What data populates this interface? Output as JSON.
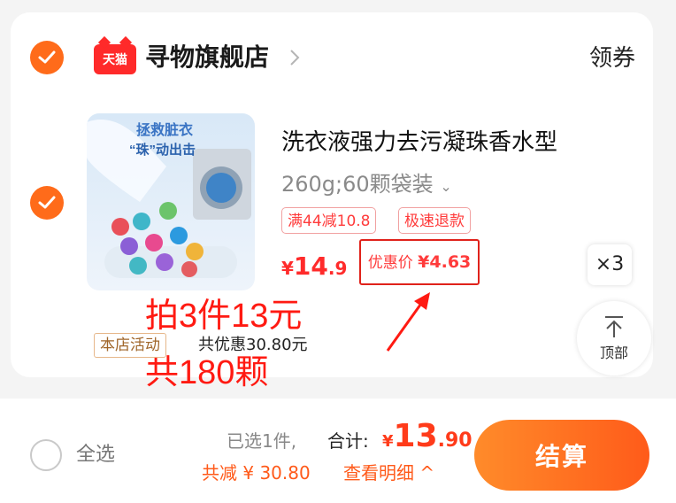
{
  "store": {
    "platform_badge": "天猫",
    "name": "寻物旗舰店",
    "coupon_label": "领券"
  },
  "product": {
    "image_text_line1": "拯救脏衣",
    "image_text_line2": "“珠”动出击",
    "title": "洗衣液强力去污凝珠香水型",
    "spec": "260g;60颗袋装",
    "tags": [
      "满44减10.8",
      "极速退款"
    ],
    "price_symbol": "¥",
    "price_int": "14",
    "price_dec": ".9",
    "coupon_price_label": "优惠价",
    "coupon_price_symbol": "¥",
    "coupon_price_value": "4.63",
    "quantity": "×3"
  },
  "annotations": {
    "line1": "拍3件13元",
    "line2": "共180颗"
  },
  "activity": {
    "badge": "本店活动",
    "text": "共优惠30.80元"
  },
  "back_to_top": {
    "label": "顶部"
  },
  "footer": {
    "select_all": "全选",
    "selected_count": "已选1件,",
    "total_label": "合计:",
    "total_symbol": "¥",
    "total_int": "13",
    "total_dec": ".90",
    "saved_text": "共减 ¥ 30.80",
    "detail_link": "查看明细 ^",
    "checkout_label": "结算"
  },
  "colors": {
    "accent": "#ff6b1a",
    "price_red": "#ff2b2b",
    "annotation_red": "#ff1a12"
  }
}
